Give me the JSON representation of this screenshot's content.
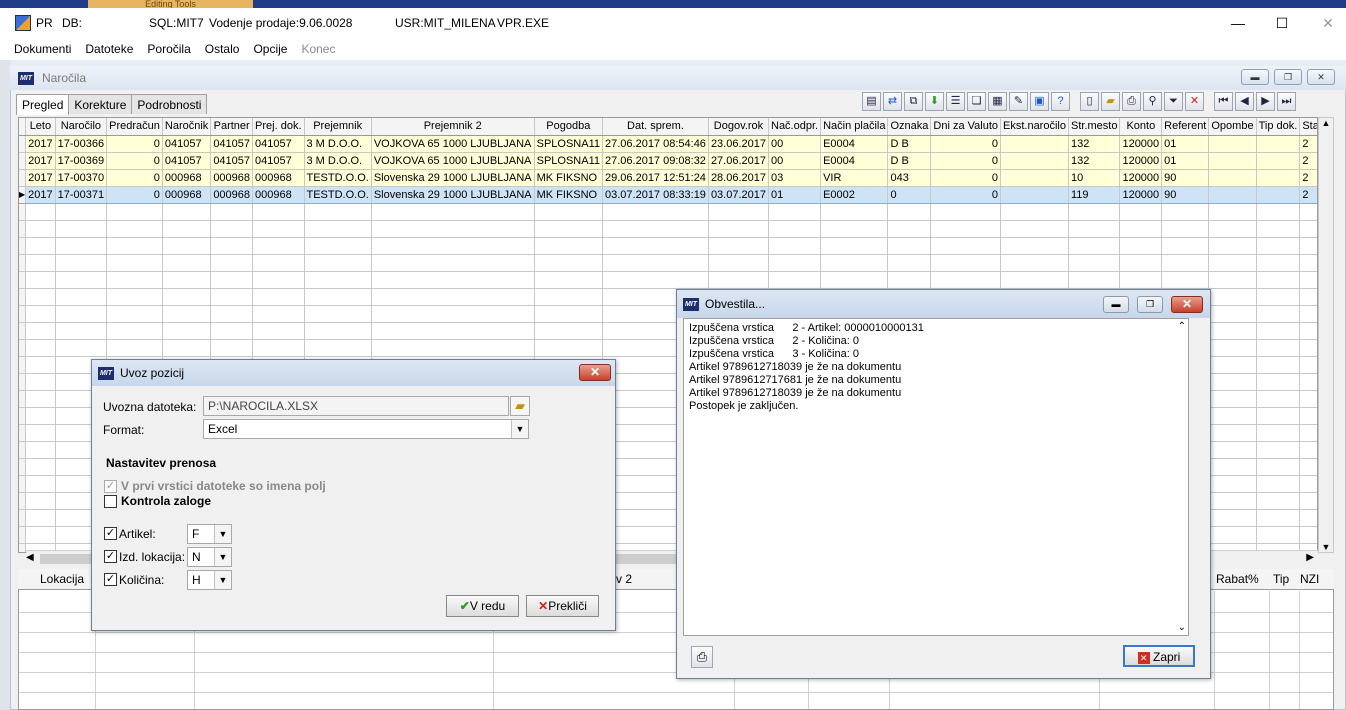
{
  "topstrip": {
    "tab_label": "Editing Tools"
  },
  "titlebar": {
    "app": "PR",
    "db_label": "DB:",
    "sql": "SQL:MIT7",
    "version": "Vodenje prodaje:9.06.0028",
    "user": "USR:MIT_MILENA",
    "exe": "VPR.EXE",
    "minimize": "—",
    "maximize": "☐",
    "close": "✕"
  },
  "menubar": {
    "items": [
      "Dokumenti",
      "Datoteke",
      "Poročila",
      "Ostalo",
      "Opcije",
      "Konec"
    ]
  },
  "child": {
    "title": "Naročila",
    "logo": "MIT",
    "tabs": [
      "Pregled",
      "Korekture",
      "Podrobnosti"
    ]
  },
  "grid": {
    "columns": [
      "Leto",
      "Naročilo",
      "Predračun",
      "Naročnik",
      "Partner",
      "Prej. dok.",
      "Prejemnik",
      "Prejemnik 2",
      "Pogodba",
      "Dat. sprem.",
      "Dogov.rok",
      "Nač.odpr.",
      "Način plačila",
      "Oznaka",
      "Dni za Valuto",
      "Ekst.naročilo",
      "Str.mesto",
      "Konto",
      "Referent",
      "Opombe",
      "Tip dok.",
      "Status"
    ],
    "rows": [
      [
        "2017",
        "17-00366",
        "0",
        "041057",
        "041057",
        "041057",
        "3 M D.O.O.",
        "VOJKOVA 65  1000    LJUBLJANA",
        "SPLOSNA11",
        "27.06.2017 08:54:46",
        "23.06.2017",
        "00",
        "E0004",
        "D B",
        "0",
        "",
        "132",
        "120000",
        "01",
        "",
        "",
        "2"
      ],
      [
        "2017",
        "17-00369",
        "0",
        "041057",
        "041057",
        "041057",
        "3 M D.O.O.",
        "VOJKOVA 65  1000    LJUBLJANA",
        "SPLOSNA11",
        "27.06.2017 09:08:32",
        "27.06.2017",
        "00",
        "E0004",
        "D B",
        "0",
        "",
        "132",
        "120000",
        "01",
        "",
        "",
        "2"
      ],
      [
        "2017",
        "17-00370",
        "0",
        "000968",
        "000968",
        "000968",
        "TESTD.O.O.",
        "Slovenska 29  1000    LJUBLJANA",
        "MK FIKSNO",
        "29.06.2017 12:51:24",
        "28.06.2017",
        "03",
        "VIR",
        "043",
        "0",
        "",
        "10",
        "120000",
        "90",
        "",
        "",
        "2"
      ],
      [
        "2017",
        "17-00371",
        "0",
        "000968",
        "000968",
        "000968",
        "TESTD.O.O.",
        "Slovenska 29  1000    LJUBLJANA",
        "MK FIKSNO",
        "03.07.2017 08:33:19",
        "03.07.2017",
        "01",
        "E0002",
        "0",
        "0",
        "",
        "119",
        "120000",
        "90",
        "",
        "",
        "2"
      ]
    ],
    "selected_row": 3
  },
  "lower_grid": {
    "headers": {
      "lokacija": "Lokacija",
      "prej2": "v 2",
      "rabat": "Rabat%",
      "tip": "Tip",
      "nzi": "NZI"
    }
  },
  "uvoz": {
    "title": "Uvoz pozicij",
    "file_label": "Uvozna datoteka:",
    "file_value": "P:\\NAROCILA.XLSX",
    "format_label": "Format:",
    "format_value": "Excel",
    "section": "Nastavitev prenosa",
    "opt_header": "V prvi vrstici datoteke so imena polj",
    "opt_stock": "Kontrola zaloge",
    "artikel_label": "Artikel:",
    "artikel_value": "F",
    "lok_label": "Izd. lokacija:",
    "lok_value": "N",
    "kol_label": "Količina:",
    "kol_value": "H",
    "ok": "V redu",
    "cancel": "Prekliči"
  },
  "obvestila": {
    "title": "Obvestila...",
    "messages": [
      "Izpuščena vrstica      2 - Artikel: 0000010000131",
      "Izpuščena vrstica      2 - Količina: 0",
      "Izpuščena vrstica      3 - Količina: 0",
      "Artikel 9789612718039 je že na dokumentu",
      "Artikel 9789612717681 je že na dokumentu",
      "Artikel 9789612718039 je že na dokumentu",
      "Postopek je zaključen."
    ],
    "close": "Zapri"
  }
}
